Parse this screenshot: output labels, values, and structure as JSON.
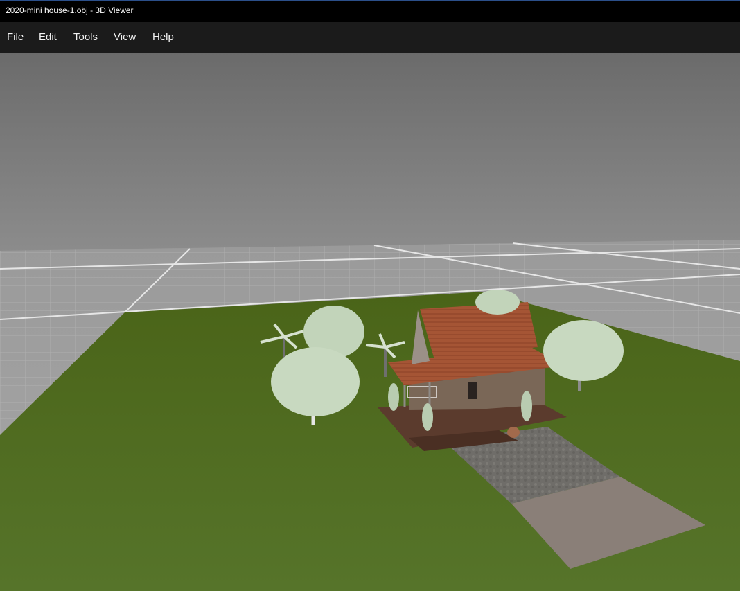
{
  "window": {
    "title": "2020-mini house-1.obj - 3D Viewer"
  },
  "menu": {
    "items": [
      {
        "id": "file",
        "label": "File"
      },
      {
        "id": "edit",
        "label": "Edit"
      },
      {
        "id": "tools",
        "label": "Tools"
      },
      {
        "id": "view",
        "label": "View"
      },
      {
        "id": "help",
        "label": "Help"
      }
    ]
  },
  "viewport": {
    "model_name": "2020-mini house-1.obj",
    "colors": {
      "sky_top": "#6e6e6e",
      "sky_bottom": "#8a8a8a",
      "grid_floor": "#a9a9a9",
      "grid_line": "#d4d4d4",
      "grass": "#4f6a1e",
      "roof": "#a9573a",
      "wall": "#7d6a5c",
      "deck": "#5a3a2c",
      "path": "#7c7a74",
      "foliage": "#c9d8c0"
    }
  }
}
